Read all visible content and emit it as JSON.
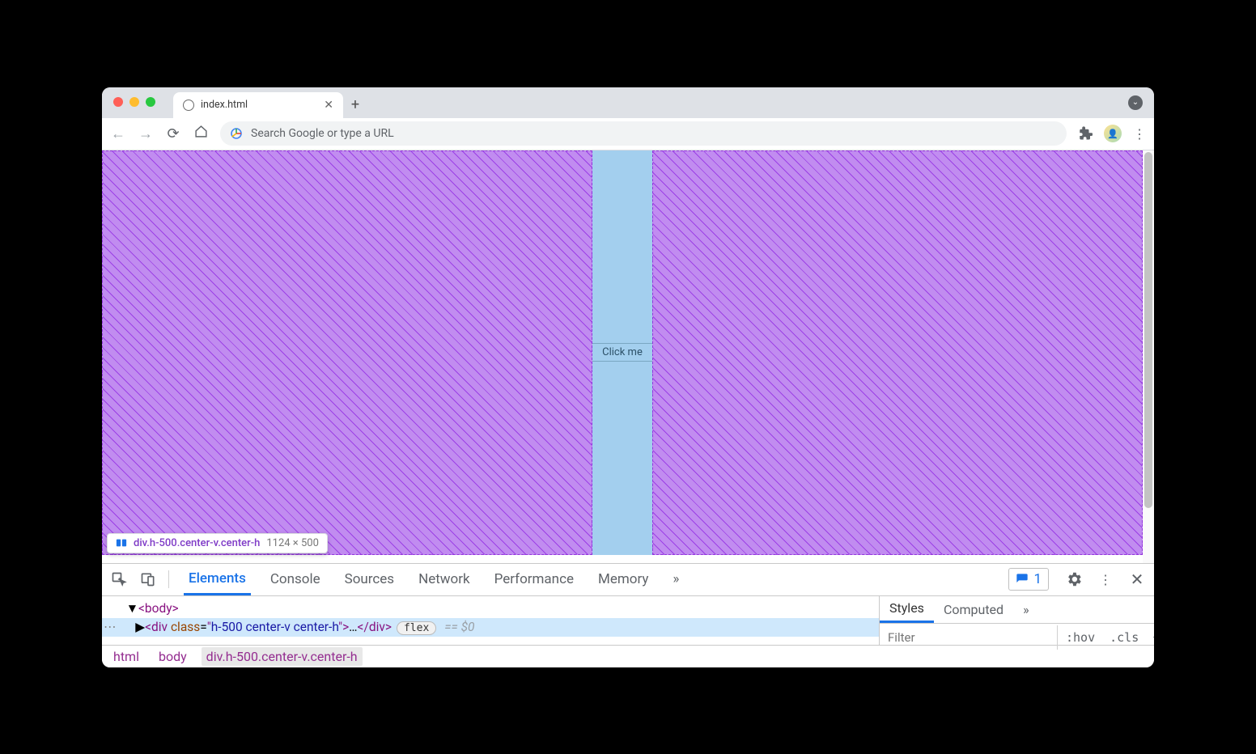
{
  "browser_tab": {
    "title": "index.html"
  },
  "omnibox": {
    "placeholder": "Search Google or type a URL"
  },
  "page": {
    "button_label": "Click me"
  },
  "element_tooltip": {
    "selector": "div.h-500.center-v.center-h",
    "dimensions": "1124 × 500"
  },
  "devtools": {
    "tabs": [
      "Elements",
      "Console",
      "Sources",
      "Network",
      "Performance",
      "Memory"
    ],
    "active_tab": "Elements",
    "issues_count": "1",
    "dom": {
      "body_open": "<body>",
      "div_tag": "div",
      "div_class": "h-500 center-v center-h",
      "flex_badge": "flex",
      "eq0": "== $0"
    },
    "breadcrumb": [
      "html",
      "body",
      "div.h-500.center-v.center-h"
    ],
    "styles": {
      "tabs": [
        "Styles",
        "Computed"
      ],
      "active_tab": "Styles",
      "filter_placeholder": "Filter",
      "hov": ":hov",
      "cls": ".cls"
    }
  }
}
